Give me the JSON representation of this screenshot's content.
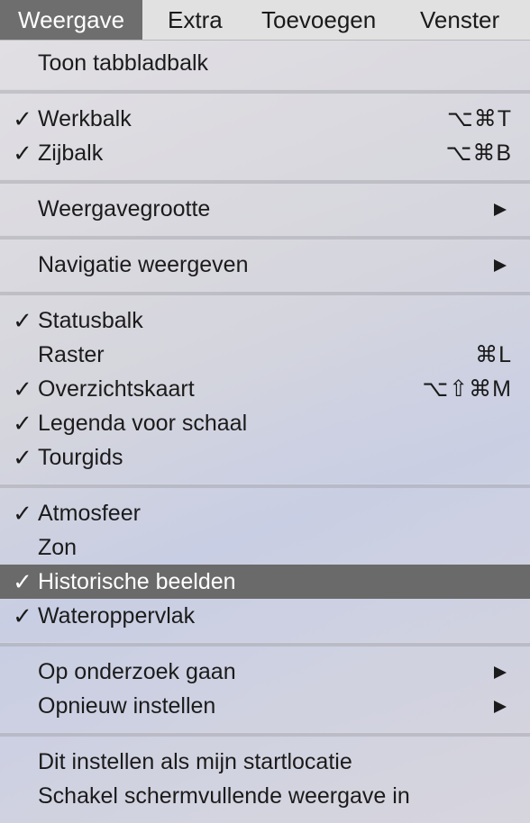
{
  "menubar": {
    "items": [
      "Weergave",
      "Extra",
      "Toevoegen",
      "Venster"
    ],
    "active_index": 0
  },
  "menu": {
    "items": [
      {
        "label": "Toon tabbladbalk",
        "checked": false,
        "shortcut": "",
        "submenu": false
      },
      {
        "label": "Werkbalk",
        "checked": true,
        "shortcut": "⌥⌘T",
        "submenu": false
      },
      {
        "label": "Zijbalk",
        "checked": true,
        "shortcut": "⌥⌘B",
        "submenu": false
      },
      {
        "label": "Weergavegrootte",
        "checked": false,
        "shortcut": "",
        "submenu": true
      },
      {
        "label": "Navigatie weergeven",
        "checked": false,
        "shortcut": "",
        "submenu": true
      },
      {
        "label": "Statusbalk",
        "checked": true,
        "shortcut": "",
        "submenu": false
      },
      {
        "label": "Raster",
        "checked": false,
        "shortcut": "⌘L",
        "submenu": false
      },
      {
        "label": "Overzichtskaart",
        "checked": true,
        "shortcut": "⌥⇧⌘M",
        "submenu": false
      },
      {
        "label": "Legenda voor schaal",
        "checked": true,
        "shortcut": "",
        "submenu": false
      },
      {
        "label": "Tourgids",
        "checked": true,
        "shortcut": "",
        "submenu": false
      },
      {
        "label": "Atmosfeer",
        "checked": true,
        "shortcut": "",
        "submenu": false
      },
      {
        "label": "Zon",
        "checked": false,
        "shortcut": "",
        "submenu": false
      },
      {
        "label": "Historische beelden",
        "checked": true,
        "shortcut": "",
        "submenu": false,
        "highlighted": true
      },
      {
        "label": "Wateroppervlak",
        "checked": true,
        "shortcut": "",
        "submenu": false
      },
      {
        "label": "Op onderzoek gaan",
        "checked": false,
        "shortcut": "",
        "submenu": true
      },
      {
        "label": "Opnieuw instellen",
        "checked": false,
        "shortcut": "",
        "submenu": true
      },
      {
        "label": "Dit instellen als mijn startlocatie",
        "checked": false,
        "shortcut": "",
        "submenu": false
      },
      {
        "label": "Schakel schermvullende weergave in",
        "checked": false,
        "shortcut": "",
        "submenu": false
      }
    ],
    "check_glyph": "✓"
  }
}
